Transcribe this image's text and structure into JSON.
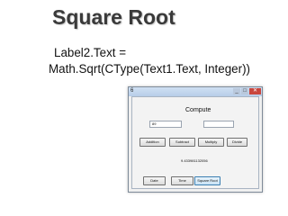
{
  "slide": {
    "title": "Square Root",
    "code_line_1": "Label2.Text =",
    "code_line_2": "Math.Sqrt(CType(Text1.Text, Integer))"
  },
  "window": {
    "title": "6",
    "heading": "Compute",
    "input1_value": "89",
    "input2_value": "",
    "buttons": {
      "addition": "Addition",
      "subtract": "Subtract",
      "multiply": "Multiply",
      "divide": "Divide",
      "date": "Date",
      "time": "Time",
      "square_root": "Square Root"
    },
    "result": "9.433981132056"
  }
}
